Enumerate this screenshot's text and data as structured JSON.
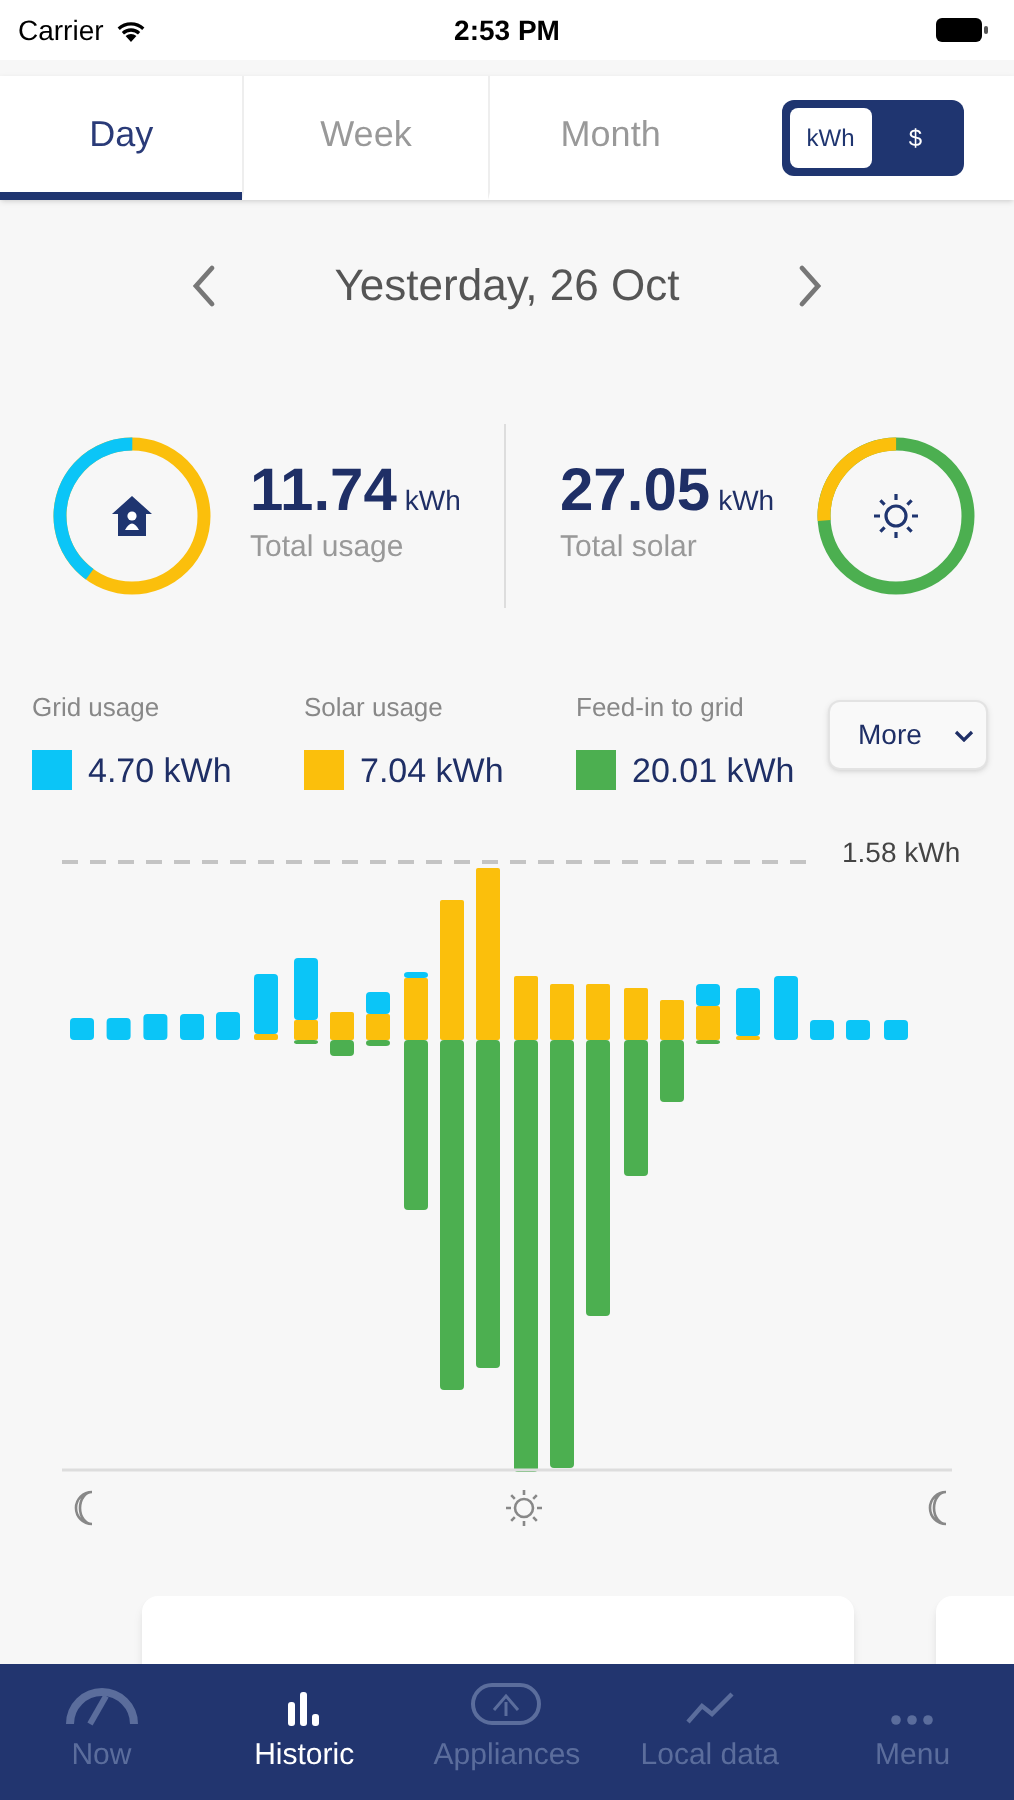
{
  "status_bar": {
    "carrier": "Carrier",
    "time": "2:53 PM"
  },
  "period_tabs": [
    {
      "label": "Day",
      "selected": true
    },
    {
      "label": "Week",
      "selected": false
    },
    {
      "label": "Month",
      "selected": false
    }
  ],
  "unit_toggle": [
    {
      "label": "kWh",
      "selected": true
    },
    {
      "label": "$",
      "selected": false
    }
  ],
  "date_nav": {
    "label": "Yesterday, 26 Oct"
  },
  "summary": [
    {
      "kind": "usage",
      "value": "11.74",
      "unit": "kWh",
      "label": "Total usage",
      "level": 0.4
    },
    {
      "kind": "solar",
      "value": "27.05",
      "unit": "kWh",
      "label": "Total solar",
      "level": 0.26
    }
  ],
  "legend": [
    {
      "label": "Grid usage",
      "value": "4.70 kWh",
      "color": "#0bc5f7"
    },
    {
      "label": "Solar usage",
      "value": "7.04 kWh",
      "color": "#fbbf0c"
    },
    {
      "label": "Feed-in to grid",
      "value": "20.01 kWh",
      "color": "#4caf50"
    }
  ],
  "more_dropdown": {
    "label": "More"
  },
  "chart": {
    "reference_label": "1.58 kWh"
  },
  "bottom_nav": [
    {
      "label": "Now",
      "selected": false
    },
    {
      "label": "Historic",
      "selected": true
    },
    {
      "label": "Appliances",
      "selected": false
    },
    {
      "label": "Local data",
      "selected": false
    },
    {
      "label": "Menu",
      "selected": false
    }
  ]
}
